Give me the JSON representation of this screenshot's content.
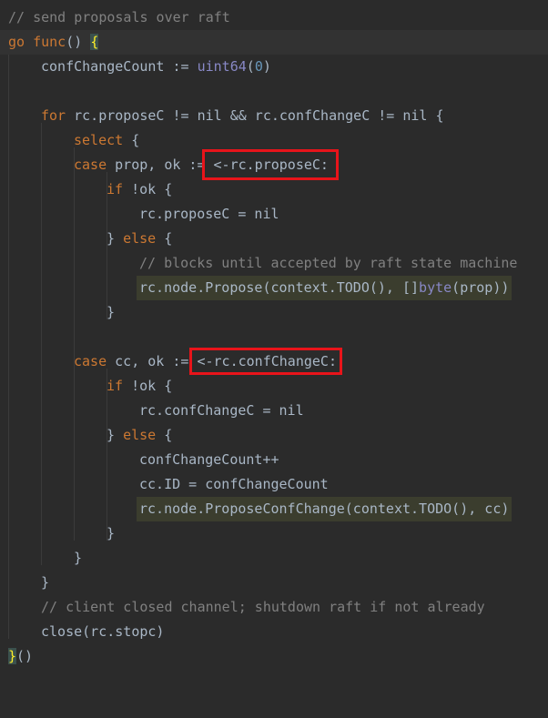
{
  "code": {
    "l01_comment": "// send proposals over raft",
    "l02_go": "go",
    "l02_func": "func",
    "l02_parens": "()",
    "l02_brace": "{",
    "l03_a": "confChangeCount := ",
    "l03_type": "uint64",
    "l03_b": "(",
    "l03_num": "0",
    "l03_c": ")",
    "l05_for": "for",
    "l05_rest": " rc.proposeC != nil && rc.confChangeC != nil {",
    "l06_select": "select",
    "l06_rest": " {",
    "l07_case": "case",
    "l07_rest": " prop, ok := ",
    "l07_box": "<-rc.proposeC:",
    "l08_if": "if",
    "l08_rest": " !ok {",
    "l09": "rc.proposeC = nil",
    "l10_a": "} ",
    "l10_else": "else",
    "l10_b": " {",
    "l11_comment": "// blocks until accepted by raft state machine",
    "l12_a": "rc.node.Propose(context.TODO(), []",
    "l12_type": "byte",
    "l12_b": "(prop))",
    "l13": "}",
    "l15_case": "case",
    "l15_rest": " cc, ok := ",
    "l15_box": "<-rc.confChangeC:",
    "l16_if": "if",
    "l16_rest": " !ok {",
    "l17": "rc.confChangeC = nil",
    "l18_a": "} ",
    "l18_else": "else",
    "l18_b": " {",
    "l19": "confChangeCount++",
    "l20": "cc.ID = confChangeCount",
    "l21": "rc.node.ProposeConfChange(context.TODO(), cc)",
    "l22": "}",
    "l23": "}",
    "l24": "}",
    "l25_comment": "// client closed channel; shutdown raft if not already",
    "l26": "close(rc.stopc)",
    "l27_brace": "}",
    "l27_parens": "()"
  },
  "colors": {
    "background": "#2b2b2b",
    "keyword": "#cc7832",
    "comment": "#808080",
    "highlight_box": "#e8141a"
  }
}
